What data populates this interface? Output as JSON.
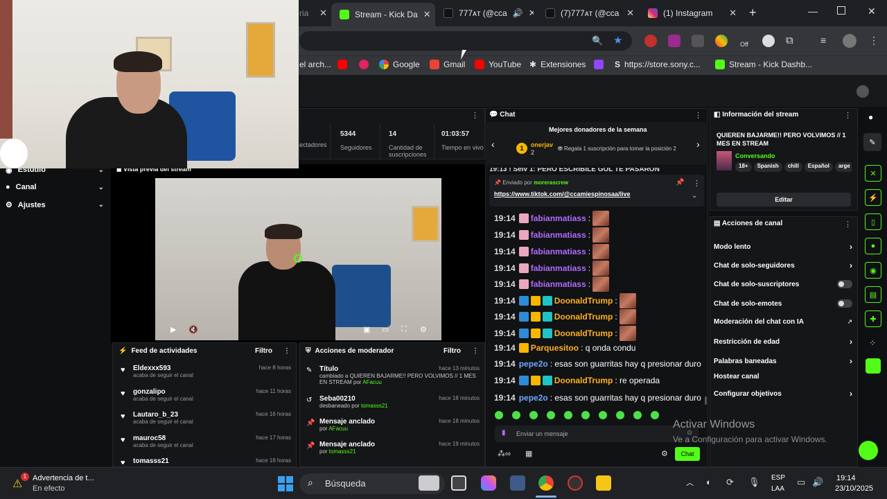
{
  "tabs": [
    {
      "label": "ria",
      "color": "#888"
    },
    {
      "label": "Stream - Kick Da",
      "color": "#53fc18"
    },
    {
      "label": "777ᴀᴛ (@cca",
      "color": "#000"
    },
    {
      "label": "(7)777ᴀᴛ (@cca",
      "color": "#000"
    },
    {
      "label": "(1) Instagram",
      "color": "#d62976"
    }
  ],
  "new_tab": "+",
  "bookmarks": [
    {
      "label": "el arch...",
      "color": "#777"
    },
    {
      "label": "",
      "color": "#ff0000"
    },
    {
      "label": "",
      "color": "#e0245e"
    },
    {
      "label": "Google",
      "color": "#4285f4"
    },
    {
      "label": "Gmail",
      "color": "#ea4335"
    },
    {
      "label": "YouTube",
      "color": "#ff0000"
    },
    {
      "label": "Extensiones",
      "color": "#ddd"
    },
    {
      "label": "",
      "color": "#9146ff"
    },
    {
      "label": "https://store.sony.c...",
      "color": "#fff"
    },
    {
      "label": "Stream - Kick Dashb...",
      "color": "#53fc18"
    }
  ],
  "ext_off": "Off",
  "stats": [
    {
      "value": "",
      "label": "ectadores"
    },
    {
      "value": "5344",
      "label": "Seguidores"
    },
    {
      "value": "14",
      "label": "Cantidad de suscripciones"
    },
    {
      "value": "01:03:57",
      "label": "Tiempo en vivo"
    }
  ],
  "sidebar": [
    {
      "label": "Estudio"
    },
    {
      "label": "Canal"
    },
    {
      "label": "Ajustes"
    }
  ],
  "preview": {
    "title": "Vista previa del stream"
  },
  "chat": {
    "title": "Chat",
    "donors_title": "Mejores donadores de la semana",
    "donor_name": "onerjav",
    "donor_count": "2",
    "donor_note": "Regala 1 suscripción para tomar la posición 2",
    "cut_line": "19:13 ! Seiv 1: PERO ESCRIBILE GOL TE PASARON",
    "pinned_by": "Enviado por",
    "pinned_user": "morerascrew",
    "pinned_link": "https://www.tiktok.com/@ccamiespinosaa/live",
    "messages": [
      {
        "time": "19:14",
        "user": "fabianmatiass",
        "text": ":",
        "color": "#b06bff",
        "emote": true,
        "badges": [
          "#e9a8c0"
        ]
      },
      {
        "time": "19:14",
        "user": "fabianmatiass",
        "text": ":",
        "color": "#b06bff",
        "emote": true,
        "badges": [
          "#e9a8c0"
        ]
      },
      {
        "time": "19:14",
        "user": "fabianmatiass",
        "text": ":",
        "color": "#b06bff",
        "emote": true,
        "badges": [
          "#e9a8c0"
        ]
      },
      {
        "time": "19:14",
        "user": "fabianmatiass",
        "text": ":",
        "color": "#b06bff",
        "emote": true,
        "badges": [
          "#e9a8c0"
        ]
      },
      {
        "time": "19:14",
        "user": "fabianmatiass",
        "text": ":",
        "color": "#b06bff",
        "emote": true,
        "badges": [
          "#e9a8c0"
        ]
      },
      {
        "time": "19:14",
        "user": "DoonaldTrump",
        "text": ":",
        "color": "#ffb020",
        "emote": true,
        "badges": [
          "#2e8bd8",
          "#f5b700",
          "#1fc4c4"
        ]
      },
      {
        "time": "19:14",
        "user": "DoonaldTrump",
        "text": ":",
        "color": "#ffb020",
        "emote": true,
        "badges": [
          "#2e8bd8",
          "#f5b700",
          "#1fc4c4"
        ]
      },
      {
        "time": "19:14",
        "user": "DoonaldTrump",
        "text": ":",
        "color": "#ffb020",
        "emote": true,
        "badges": [
          "#2e8bd8",
          "#f5b700",
          "#1fc4c4"
        ]
      },
      {
        "time": "19:14",
        "user": "Parquesitoo",
        "text": ": q onda condu",
        "color": "#ffb020",
        "emote": false,
        "badges": [
          "#f5b700"
        ]
      },
      {
        "time": "19:14",
        "user": "pepe2o",
        "text": ": esas son guarritas hay q presionar duro",
        "color": "#6fa8ff",
        "emote": false,
        "badges": []
      },
      {
        "time": "19:14",
        "user": "DoonaldTrump",
        "text": ": re operada",
        "color": "#ffb020",
        "emote": false,
        "badges": [
          "#2e8bd8",
          "#f5b700",
          "#1fc4c4"
        ]
      },
      {
        "time": "19:14",
        "user": "pepe2o",
        "text": ": esas son guarritas hay q presionar duro",
        "color": "#6fa8ff",
        "emote": false,
        "badges": []
      }
    ],
    "input_placeholder": "Enviar un mensaje",
    "send_label": "Chat"
  },
  "feed": {
    "title": "Feed de actividades",
    "filter": "Filtro",
    "items": [
      {
        "name": "Eldexxx593",
        "sub": "acaba de seguir el canal",
        "time": "hace 8 horas"
      },
      {
        "name": "gonzalipo",
        "sub": "acaba de seguir el canal",
        "time": "hace 11 horas"
      },
      {
        "name": "Lautaro_b_23",
        "sub": "acaba de seguir el canal",
        "time": "hace 16 horas"
      },
      {
        "name": "mauroc58",
        "sub": "acaba de seguir el canal",
        "time": "hace 17 horas"
      },
      {
        "name": "tomasss21",
        "sub": "",
        "time": "hace 18 horas"
      }
    ]
  },
  "mod": {
    "title": "Acciones de moderador",
    "filter": "Filtro",
    "items": [
      {
        "name": "Título",
        "sub": "cambiado a QUIEREN BAJARME!! PERO VOLVIMOS // 1 MES EN STREAM por",
        "who": "AFacuu",
        "time": "hace 13 minutos"
      },
      {
        "name": "Seba00210",
        "sub": "desbaneado por",
        "who": "tomasss21",
        "time": "hace 18 minutos"
      },
      {
        "name": "Mensaje anclado",
        "sub": "por",
        "who": "AFacuu",
        "time": "hace 18 minutos"
      },
      {
        "name": "Mensaje anclado",
        "sub": "por",
        "who": "tomasss21",
        "time": "hace 19 minutos"
      }
    ]
  },
  "info": {
    "title": "Información del stream",
    "stream_title": "QUIEREN BAJARME!! PERO VOLVIMOS // 1 MES EN STREAM",
    "category": "Conversando",
    "tags": [
      "18+",
      "Spanish",
      "chill",
      "Español",
      "arge"
    ],
    "edit": "Editar"
  },
  "channel_actions": {
    "title": "Acciones de canal",
    "rows": [
      {
        "label": "Modo lento",
        "ctrl": "chev"
      },
      {
        "label": "Chat de solo-seguidores",
        "ctrl": "chev"
      },
      {
        "label": "Chat de solo-suscriptores",
        "ctrl": "toggle"
      },
      {
        "label": "Chat de solo-emotes",
        "ctrl": "toggle"
      },
      {
        "label": "Moderación del chat con IA",
        "ctrl": "ext"
      },
      {
        "label": "Restricción de edad",
        "ctrl": "chev"
      },
      {
        "label": "Palabras baneadas",
        "ctrl": "chev"
      },
      {
        "label": "Hostear canal",
        "ctrl": "none"
      },
      {
        "label": "Configurar objetivos",
        "ctrl": "chev"
      }
    ]
  },
  "watermark": {
    "line1": "Activar Windows",
    "line2": "Ve a Configuración para activar Windows."
  },
  "taskbar": {
    "notif_title": "Advertencia de t...",
    "notif_sub": "En efecto",
    "notif_badge": "1",
    "search": "Búsqueda",
    "lang1": "ESP",
    "lang2": "LAA",
    "time": "19:14",
    "date": "23/10/2025"
  }
}
